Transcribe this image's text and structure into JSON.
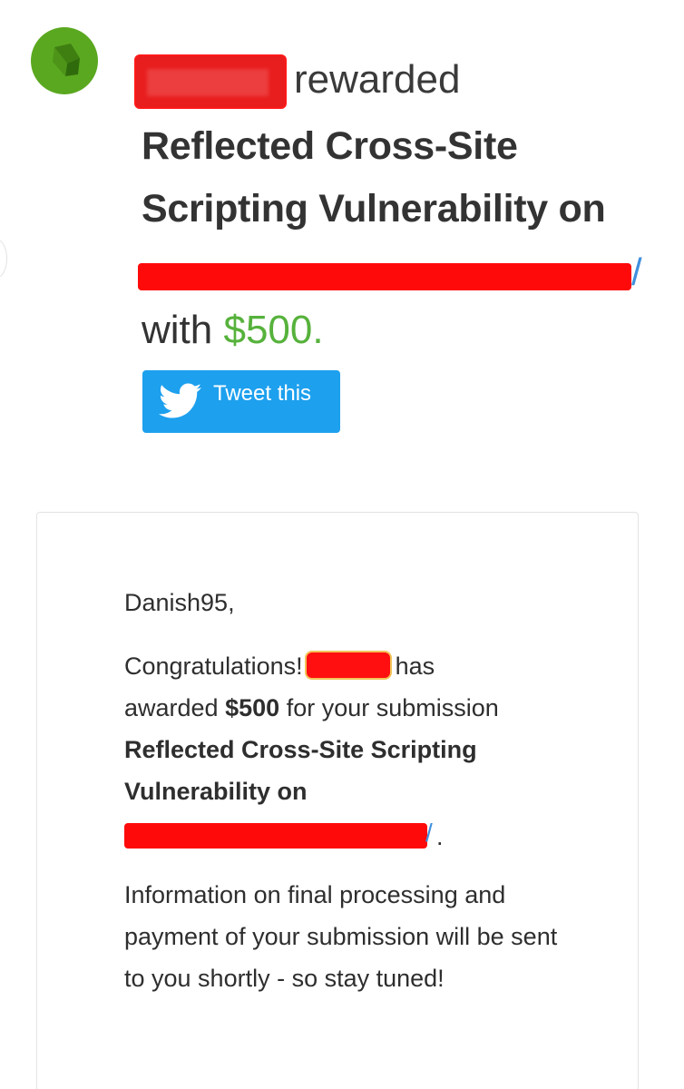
{
  "header": {
    "rewarded_word": "rewarded",
    "title_line1": "Reflected Cross-Site",
    "title_line2": "Scripting Vulnerability on",
    "url_slash": "/",
    "with_word": "with",
    "amount": "$500."
  },
  "tweet_button": {
    "label": "Tweet this",
    "color": "#1da0ee"
  },
  "colors": {
    "accent_green": "#56b23b",
    "link_blue": "#3f8fdd",
    "redaction_red": "#ff0a0a"
  },
  "email": {
    "greeting": "Danish95,",
    "congrats": "Congratulations!",
    "has": "has",
    "awarded": "awarded",
    "amount": "$500",
    "for_submission": "for your submission",
    "title_a": "Reflected Cross-Site Scripting",
    "title_b": "Vulnerability on",
    "url_slash": "/",
    "period": ".",
    "info": "Information on final processing and payment of your submission will be sent to you shortly - so stay tuned!"
  }
}
